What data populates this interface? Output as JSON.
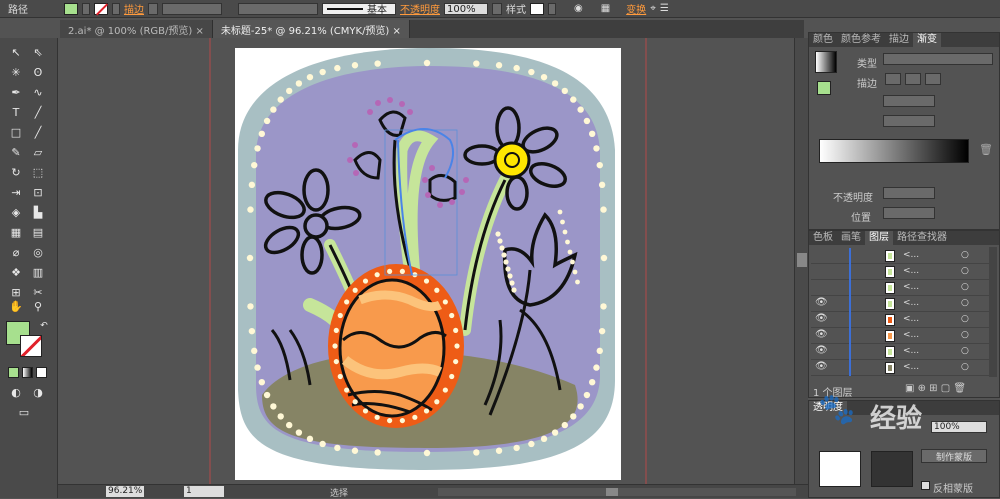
{
  "controlbar": {
    "object_type": "路径",
    "stroke_label": "描边",
    "stroke_profile": "基本",
    "opacity_label": "不透明度",
    "opacity_value": "100%",
    "style_label": "样式",
    "transform_label": "变换"
  },
  "doc_tabs": [
    {
      "label": "2.ai* @ 100% (RGB/预览)",
      "active": false
    },
    {
      "label": "未标题-25* @ 96.21% (CMYK/预览)",
      "active": true
    }
  ],
  "status": {
    "zoom": "96.21%",
    "page": "1",
    "tool": "选择"
  },
  "gradient_panel": {
    "tabs": [
      "颜色",
      "颜色参考",
      "描边",
      "渐变"
    ],
    "active_tab": "渐变",
    "type_label": "类型",
    "stroke_label": "描边",
    "opacity_label": "不透明度",
    "position_label": "位置"
  },
  "layers_panel": {
    "tabs": [
      "色板",
      "画笔",
      "图层",
      "路径查找器"
    ],
    "active_tab": "图层",
    "row_labels": [
      "<...",
      "<...",
      "<...",
      "<...",
      "<...",
      "<...",
      "<...",
      "<..."
    ],
    "footer": "1 个图层"
  },
  "transparency_panel": {
    "tab": "透明度",
    "opacity_value": "100%",
    "mask_button": "制作蒙版",
    "invert_mask": "反相蒙版"
  },
  "watermark": {
    "text": "经验"
  },
  "colors": {
    "fill": "#a7e08e",
    "border_blue": "#a8bfc3",
    "inner_purple": "#9b96c8",
    "ground": "#868465",
    "egg_orange": "#ee5c16",
    "egg_light": "#f89a4c",
    "stem_green": "#c6e59a",
    "dot_cream": "#fff8d6",
    "center_yellow": "#ffe600",
    "pink_dot": "#b567b6"
  }
}
